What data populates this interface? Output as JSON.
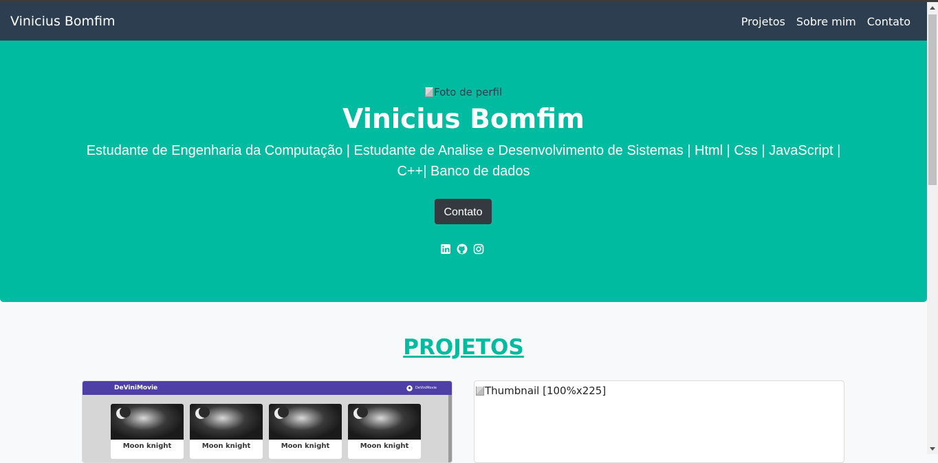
{
  "navbar": {
    "brand": "Vinicius Bomfim",
    "links": [
      "Projetos",
      "Sobre mim",
      "Contato"
    ]
  },
  "hero": {
    "profile_alt": "Foto de perfil",
    "name": "Vinicius Bomfim",
    "subtitle_line1": "Estudante de Engenharia da Computação | Estudante de Analise e Desenvolvimento de Sistemas | Html | Css | JavaScript |",
    "subtitle_line2": "C++| Banco de dados",
    "button_label": "Contato",
    "social_icons": [
      "linkedin-icon",
      "github-icon",
      "instagram-icon"
    ],
    "background_color": "#00bb9f"
  },
  "projects": {
    "section_title": "PROJETOS",
    "card1": {
      "app_name": "DeViniMovie",
      "github_label": "DeViniMovie",
      "movies": [
        "Moon knight",
        "Moon knight",
        "Moon knight",
        "Moon knight"
      ]
    },
    "card2": {
      "thumb_alt": "Thumbnail [100%x225]"
    }
  },
  "colors": {
    "navbar": "#2c3e50",
    "accent": "#00bb9f",
    "button": "#343a40"
  }
}
